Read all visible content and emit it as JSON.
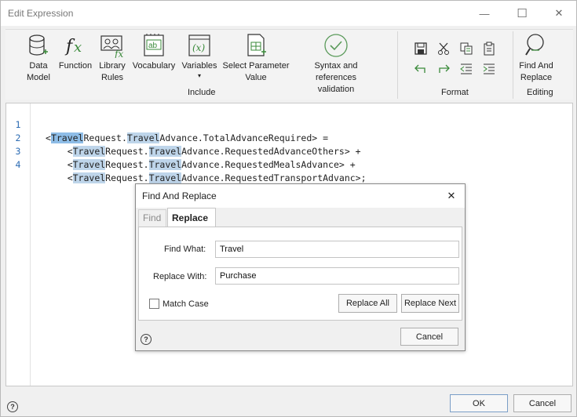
{
  "window": {
    "title": "Edit Expression",
    "minimize": "—",
    "maximize": "☐",
    "close": "✕"
  },
  "ribbon": {
    "tools": [
      {
        "line1": "Data",
        "line2": "Model"
      },
      {
        "line1": "Function",
        "line2": ""
      },
      {
        "line1": "Library",
        "line2": "Rules"
      },
      {
        "line1": "Vocabulary",
        "line2": ""
      },
      {
        "line1": "Variables",
        "line2": "▾"
      },
      {
        "line1": "Select Parameter",
        "line2": "Value"
      },
      {
        "line1": "Syntax and references",
        "line2": "validation"
      },
      {
        "line1": "Find And",
        "line2": "Replace"
      }
    ],
    "groups": {
      "include": "Include",
      "format": "Format",
      "editing": "Editing"
    }
  },
  "editor": {
    "lines": [
      {
        "num": "1",
        "parts": [
          "<",
          "Travel",
          "Request.",
          "Travel",
          "Advance.TotalAdvanceRequired> ="
        ]
      },
      {
        "num": "2",
        "parts": [
          "    <",
          "Travel",
          "Request.",
          "Travel",
          "Advance.RequestedAdvanceOthers> +"
        ]
      },
      {
        "num": "3",
        "parts": [
          "    <",
          "Travel",
          "Request.",
          "Travel",
          "Advance.RequestedMealsAdvance> +"
        ]
      },
      {
        "num": "4",
        "parts": [
          "    <",
          "Travel",
          "Request.",
          "Travel",
          "Advance.RequestedTransportAdvanc>;"
        ]
      }
    ]
  },
  "dialog": {
    "title": "Find And Replace",
    "close": "✕",
    "tab_find": "Find",
    "tab_replace": "Replace",
    "find_what_label": "Find What:",
    "find_what_value": "Travel",
    "replace_with_label": "Replace With:",
    "replace_with_value": "Purchase",
    "match_case_label": "Match Case",
    "replace_all": "Replace All",
    "replace_next": "Replace Next",
    "cancel": "Cancel",
    "help": "?"
  },
  "footer": {
    "ok": "OK",
    "cancel": "Cancel",
    "help": "?"
  }
}
